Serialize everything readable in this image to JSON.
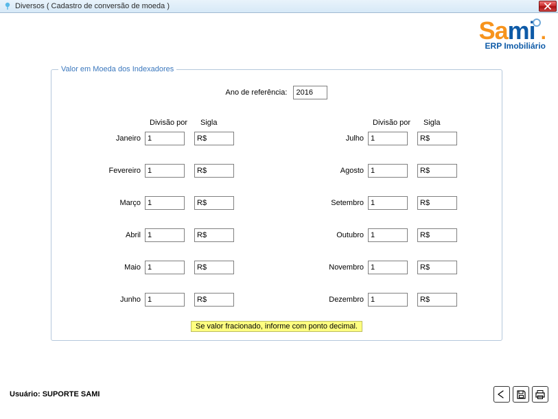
{
  "window": {
    "title": "Diversos ( Cadastro de conversão de moeda )"
  },
  "logo": {
    "sub": "ERP Imobiliário"
  },
  "group": {
    "legend": "Valor em Moeda dos Indexadores",
    "ref_label": "Ano de referência:",
    "ref_value": "2016",
    "headers": {
      "divisao": "Divisão por",
      "sigla": "Sigla"
    },
    "months_left": [
      {
        "label": "Janeiro",
        "div": "1",
        "sig": "R$"
      },
      {
        "label": "Fevereiro",
        "div": "1",
        "sig": "R$"
      },
      {
        "label": "Março",
        "div": "1",
        "sig": "R$"
      },
      {
        "label": "Abril",
        "div": "1",
        "sig": "R$"
      },
      {
        "label": "Maio",
        "div": "1",
        "sig": "R$"
      },
      {
        "label": "Junho",
        "div": "1",
        "sig": "R$"
      }
    ],
    "months_right": [
      {
        "label": "Julho",
        "div": "1",
        "sig": "R$"
      },
      {
        "label": "Agosto",
        "div": "1",
        "sig": "R$"
      },
      {
        "label": "Setembro",
        "div": "1",
        "sig": "R$"
      },
      {
        "label": "Outubro",
        "div": "1",
        "sig": "R$"
      },
      {
        "label": "Novembro",
        "div": "1",
        "sig": "R$"
      },
      {
        "label": "Dezembro",
        "div": "1",
        "sig": "R$"
      }
    ],
    "hint": "Se valor fracionado, informe com ponto decimal."
  },
  "footer": {
    "user_label": "Usuário:",
    "user_name": "SUPORTE SAMI"
  }
}
